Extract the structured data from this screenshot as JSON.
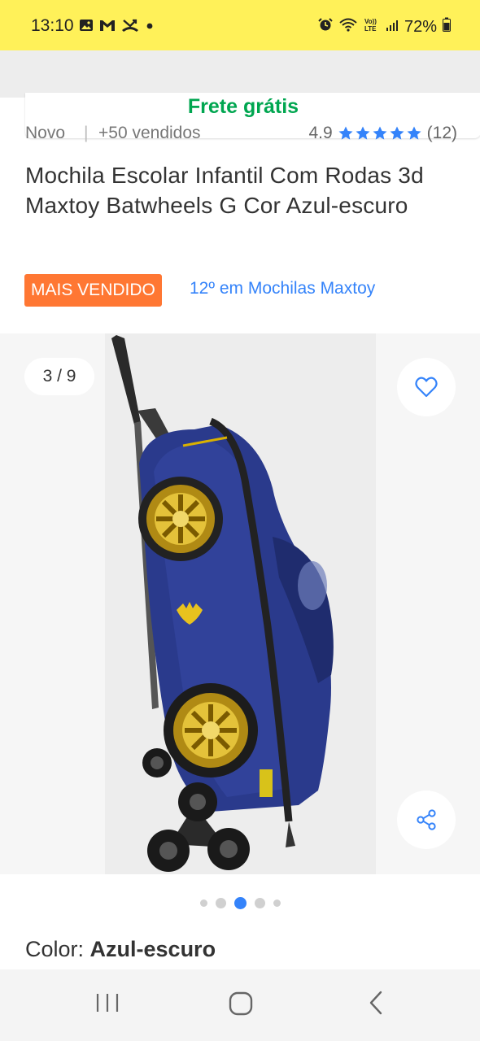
{
  "status_bar": {
    "time": "13:10",
    "battery": "72%",
    "left_icons": [
      "gallery-icon",
      "gmail-icon",
      "missed-call-icon",
      "dot-icon"
    ],
    "right_icons": [
      "alarm-icon",
      "wifi-calling-icon",
      "volte-icon",
      "signal-icon",
      "battery-icon"
    ]
  },
  "shipping": {
    "label": "Frete grátis"
  },
  "product": {
    "condition": "Novo",
    "separator": "|",
    "sold": "+50 vendidos",
    "rating": "4.9",
    "review_count": "(12)",
    "stars": 5,
    "title": "Mochila Escolar Infantil Com Rodas 3d Maxtoy Batwheels G Cor Azul-escuro",
    "badge": "MAIS VENDIDO",
    "ranking": "12º em Mochilas Maxtoy"
  },
  "gallery": {
    "counter": "3 / 9",
    "current_index": 3,
    "total": 9,
    "favorite_icon": "heart-icon",
    "share_icon": "share-icon"
  },
  "variant": {
    "label": "Color: ",
    "value": "Azul-escuro"
  },
  "colors": {
    "brand_yellow": "#fff159",
    "accent_blue": "#3483fa",
    "free_shipping_green": "#00a650",
    "badge_orange": "#ff7733"
  },
  "nav_bar": {
    "buttons": [
      "recents-icon",
      "home-icon",
      "back-icon"
    ]
  }
}
